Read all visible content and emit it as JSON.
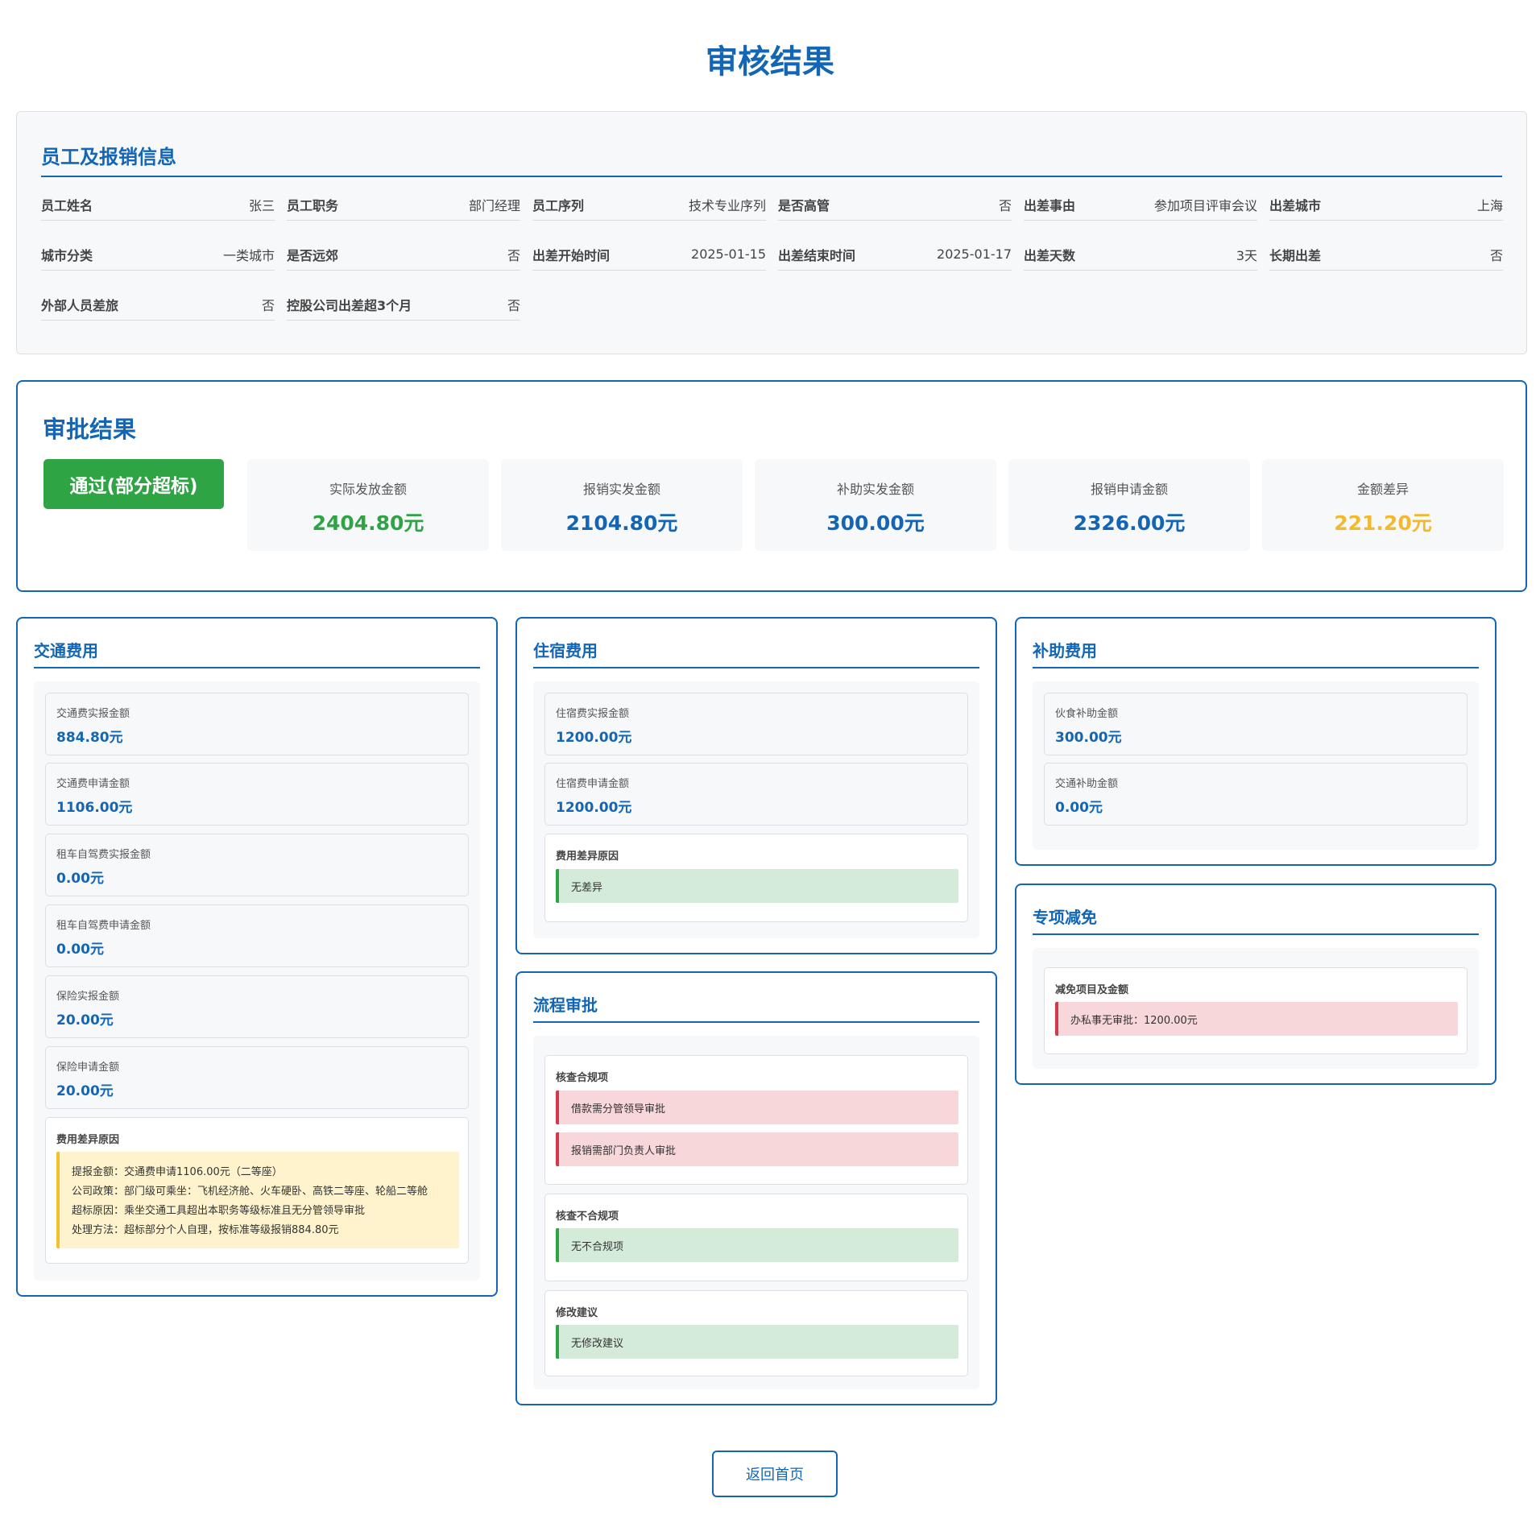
{
  "page_title": "审核结果",
  "employee_info": {
    "title": "员工及报销信息",
    "fields": [
      {
        "label": "员工姓名",
        "value": "张三"
      },
      {
        "label": "员工职务",
        "value": "部门经理"
      },
      {
        "label": "员工序列",
        "value": "技术专业序列"
      },
      {
        "label": "是否高管",
        "value": "否"
      },
      {
        "label": "出差事由",
        "value": "参加项目评审会议"
      },
      {
        "label": "出差城市",
        "value": "上海"
      },
      {
        "label": "城市分类",
        "value": "一类城市"
      },
      {
        "label": "是否远郊",
        "value": "否"
      },
      {
        "label": "出差开始时间",
        "value": "2025-01-15"
      },
      {
        "label": "出差结束时间",
        "value": "2025-01-17"
      },
      {
        "label": "出差天数",
        "value": "3天"
      },
      {
        "label": "长期出差",
        "value": "否"
      },
      {
        "label": "外部人员差旅",
        "value": "否"
      },
      {
        "label": "控股公司出差超3个月",
        "value": "否"
      }
    ]
  },
  "approval": {
    "title": "审批结果",
    "status": "通过(部分超标)",
    "metrics": [
      {
        "label": "实际发放金额",
        "value": "2404.80元",
        "color": "#2ea444"
      },
      {
        "label": "报销实发金额",
        "value": "2104.80元",
        "color": "#1266b5"
      },
      {
        "label": "补助实发金额",
        "value": "300.00元",
        "color": "#1266b5"
      },
      {
        "label": "报销申请金额",
        "value": "2326.00元",
        "color": "#1266b5"
      },
      {
        "label": "金额差异",
        "value": "221.20元",
        "color": "#f2b92e"
      }
    ]
  },
  "transport": {
    "title": "交通费用",
    "amounts": [
      {
        "label": "交通费实报金额",
        "value": "884.80元"
      },
      {
        "label": "交通费申请金额",
        "value": "1106.00元"
      },
      {
        "label": "租车自驾费实报金额",
        "value": "0.00元"
      },
      {
        "label": "租车自驾费申请金额",
        "value": "0.00元"
      },
      {
        "label": "保险实报金额",
        "value": "20.00元"
      },
      {
        "label": "保险申请金额",
        "value": "20.00元"
      }
    ],
    "diff_label": "费用差异原因",
    "diff_lines": [
      "提报金额：交通费申请1106.00元（二等座）",
      "公司政策：部门级可乘坐：飞机经济舱、火车硬卧、高铁二等座、轮船二等舱",
      "超标原因：乘坐交通工具超出本职务等级标准且无分管领导审批",
      "处理方法：超标部分个人自理，按标准等级报销884.80元"
    ]
  },
  "lodging": {
    "title": "住宿费用",
    "amounts": [
      {
        "label": "住宿费实报金额",
        "value": "1200.00元"
      },
      {
        "label": "住宿费申请金额",
        "value": "1200.00元"
      }
    ],
    "diff_label": "费用差异原因",
    "diff_value": "无差异"
  },
  "subsidy": {
    "title": "补助费用",
    "amounts": [
      {
        "label": "伙食补助金额",
        "value": "300.00元"
      },
      {
        "label": "交通补助金额",
        "value": "0.00元"
      }
    ]
  },
  "deduction": {
    "title": "专项减免",
    "label": "减免项目及金额",
    "value": "办私事无审批：1200.00元"
  },
  "process": {
    "title": "流程审批",
    "compliant_label": "核查合规项",
    "compliant_items": [
      "借款需分管领导审批",
      "报销需部门负责人审批"
    ],
    "noncompliant_label": "核查不合规项",
    "noncompliant_value": "无不合规项",
    "suggestion_label": "修改建议",
    "suggestion_value": "无修改建议"
  },
  "back_button": "返回首页"
}
